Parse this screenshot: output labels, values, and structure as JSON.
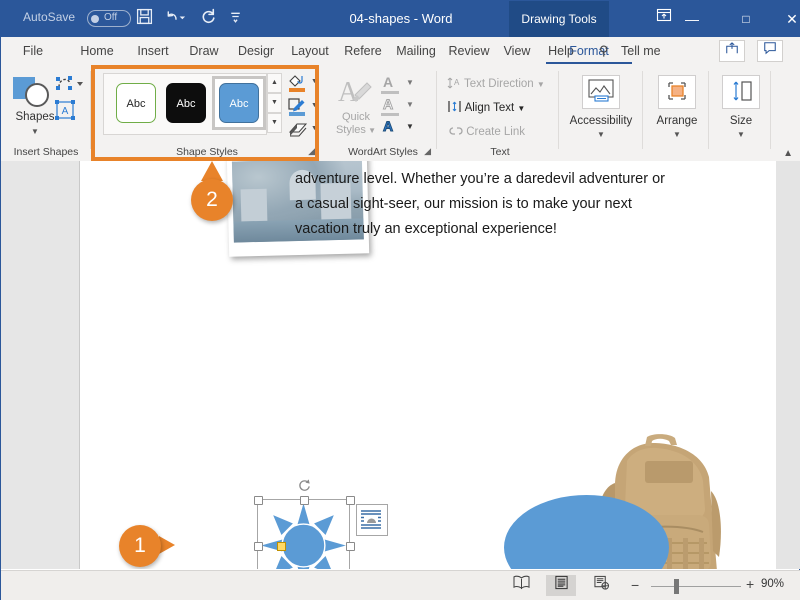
{
  "titlebar": {
    "autosave_label": "AutoSave",
    "autosave_state": "Off",
    "save_icon": "save-icon",
    "undo_icon": "undo-icon",
    "redo_icon": "redo-icon",
    "qat_more_icon": "customize-quick-access-toolbar-icon",
    "document_title": "04-shapes - Word",
    "contextual_tab": "Drawing Tools",
    "ribbon_display_icon": "ribbon-display-options-icon",
    "minimize_icon": "minimize-icon",
    "maximize_icon": "maximize-icon",
    "close_icon": "close-icon",
    "accent": "#2b579a",
    "contextual_accent": "#204b86"
  },
  "tabs": [
    {
      "label": "File"
    },
    {
      "label": "Home"
    },
    {
      "label": "Insert"
    },
    {
      "label": "Draw"
    },
    {
      "label": "Desigr"
    },
    {
      "label": "Layout"
    },
    {
      "label": "Refere"
    },
    {
      "label": "Mailing"
    },
    {
      "label": "Review"
    },
    {
      "label": "View"
    },
    {
      "label": "Help"
    },
    {
      "label": "Format"
    }
  ],
  "tellme": {
    "label": "Tell me",
    "icon": "search-icon"
  },
  "titlebar_right_buttons": {
    "share_icon": "share-icon",
    "comments_icon": "comments-icon"
  },
  "ribbon": {
    "groups": [
      {
        "name": "insert-shapes",
        "label": "Insert Shapes",
        "shapes_button": "Shapes",
        "edit_shape_icon": "edit-shape-icon",
        "text-box_icon": "draw-text-box-icon"
      },
      {
        "name": "shape-styles",
        "label": "Shape Styles",
        "gallery": [
          {
            "label": "Abc",
            "style": "subtle-line-accent"
          },
          {
            "label": "Abc",
            "style": "intense-fill-dark"
          },
          {
            "label": "Abc",
            "style": "colored-fill-blue",
            "selected": true
          }
        ],
        "scroll_up_icon": "scroll-up-icon",
        "scroll_down_icon": "scroll-down-icon",
        "more_icon": "more-styles-icon",
        "shape_fill_icon": "shape-fill-icon",
        "shape_outline_icon": "shape-outline-icon",
        "shape_effects_icon": "shape-effects-icon",
        "dialog_launcher_icon": "dialog-launcher-icon",
        "fill_color": "#e8832a",
        "outline_color": "#5b9bd5"
      },
      {
        "name": "wordart-styles",
        "label": "WordArt Styles",
        "quick_styles_label_line1": "Quick",
        "quick_styles_label_line2": "Styles",
        "quick_styles_icon": "wordart-quick-styles-icon",
        "text_fill_icon": "text-fill-icon",
        "text_outline_icon": "text-outline-icon",
        "text_effects_icon": "text-effects-icon",
        "dialog_launcher_icon": "dialog-launcher-icon"
      },
      {
        "name": "text",
        "label": "Text",
        "items": [
          {
            "label": "Text Direction",
            "icon": "text-direction-icon",
            "enabled": false
          },
          {
            "label": "Align Text",
            "icon": "align-text-icon",
            "enabled": true
          },
          {
            "label": "Create Link",
            "icon": "create-link-icon",
            "enabled": false
          }
        ]
      },
      {
        "name": "accessibility",
        "label": "Accessibility",
        "button": "Accessibility",
        "icon": "check-accessibility-icon"
      },
      {
        "name": "arrange",
        "label": "Arrange",
        "button": "Arrange",
        "icon": "arrange-objects-icon"
      },
      {
        "name": "size",
        "label": "Size",
        "button": "Size",
        "icon": "size-icon"
      }
    ],
    "collapse_ribbon_icon": "collapse-ribbon-icon"
  },
  "document": {
    "body_text": "adventure level. Whether you’re a daredevil adventurer or a casual sight-seer, our mission is to make your next vacation truly an exceptional experience!",
    "photo_alt": "city-photograph",
    "backpack_alt": "backpack-photograph",
    "star_shape": {
      "name": "8-point-star-shape",
      "fill": "#5b9bd5",
      "selected": true
    },
    "ellipse_shape": {
      "name": "ellipse-shape",
      "fill": "#5b9bd5"
    },
    "layout_options_icon": "layout-options-icon",
    "rotate_handle_icon": "rotate-handle-icon"
  },
  "callouts": [
    {
      "number": "1",
      "direction": "right",
      "target": "star-shape"
    },
    {
      "number": "2",
      "direction": "up",
      "target": "shape-styles-group"
    }
  ],
  "highlight": {
    "color": "#e8832a",
    "target": "shape-styles-group"
  },
  "statusbar": {
    "read_mode_icon": "read-mode-icon",
    "print_layout_icon": "print-layout-icon",
    "web_layout_icon": "web-layout-icon",
    "zoom_out_label": "−",
    "zoom_in_label": "+",
    "zoom_value": "90%"
  }
}
